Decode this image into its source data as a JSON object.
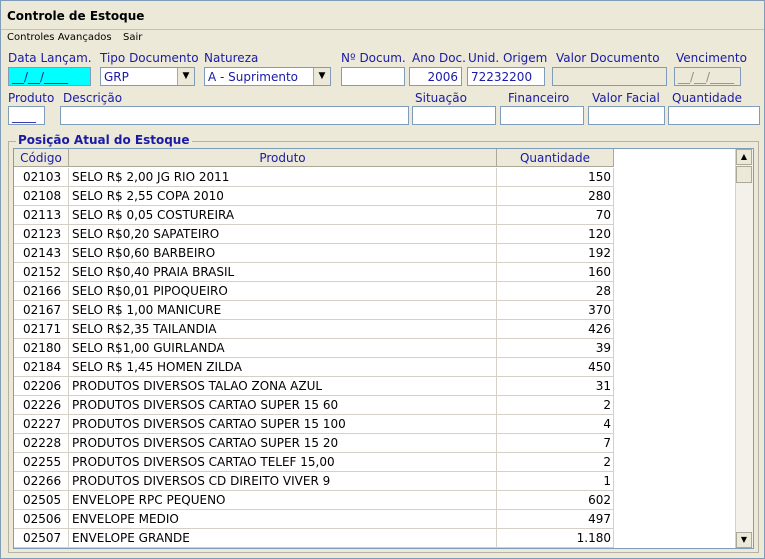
{
  "window": {
    "title": "Controle de Estoque"
  },
  "menu": {
    "items": [
      "Controles Avançados",
      "Sair"
    ]
  },
  "form": {
    "data_lanc": {
      "label": "Data Lançam.",
      "value": "__/__/____"
    },
    "tipo_doc": {
      "label": "Tipo Documento",
      "value": "GRP"
    },
    "natureza": {
      "label": "Natureza",
      "value": "A - Suprimento"
    },
    "num_doc": {
      "label": "Nº Docum.",
      "value": ""
    },
    "ano_doc": {
      "label": "Ano Doc.",
      "value": "2006"
    },
    "unid_origem": {
      "label": "Unid. Origem",
      "value": "72232200"
    },
    "valor_doc": {
      "label": "Valor Documento",
      "value": ""
    },
    "vencimento": {
      "label": "Vencimento",
      "value": "__/__/____"
    },
    "produto": {
      "label": "Produto",
      "value": "____"
    },
    "descricao": {
      "label": "Descrição",
      "value": ""
    },
    "situacao": {
      "label": "Situação",
      "value": ""
    },
    "financeiro": {
      "label": "Financeiro",
      "value": ""
    },
    "valor_facial": {
      "label": "Valor Facial",
      "value": ""
    },
    "quantidade": {
      "label": "Quantidade",
      "value": ""
    }
  },
  "stock": {
    "group_title": "Posição Atual do Estoque",
    "columns": [
      "Código",
      "Produto",
      "Quantidade"
    ],
    "rows": [
      [
        "02103",
        "SELO R$ 2,00 JG RIO 2011",
        "150"
      ],
      [
        "02108",
        "SELO R$ 2,55 COPA 2010",
        "280"
      ],
      [
        "02113",
        "SELO R$ 0,05 COSTUREIRA",
        "70"
      ],
      [
        "02123",
        "SELO R$0,20 SAPATEIRO",
        "120"
      ],
      [
        "02143",
        "SELO R$0,60 BARBEIRO",
        "192"
      ],
      [
        "02152",
        "SELO R$0,40 PRAIA BRASIL",
        "160"
      ],
      [
        "02166",
        "SELO R$0,01 PIPOQUEIRO",
        "28"
      ],
      [
        "02167",
        "SELO R$ 1,00 MANICURE",
        "370"
      ],
      [
        "02171",
        "SELO R$2,35 TAILANDIA",
        "426"
      ],
      [
        "02180",
        "SELO R$1,00 GUIRLANDA",
        "39"
      ],
      [
        "02184",
        "SELO R$ 1,45 HOMEN ZILDA",
        "450"
      ],
      [
        "02206",
        "PRODUTOS DIVERSOS TALAO ZONA AZUL",
        "31"
      ],
      [
        "02226",
        "PRODUTOS DIVERSOS CARTAO SUPER 15  60",
        "2"
      ],
      [
        "02227",
        "PRODUTOS DIVERSOS CARTAO SUPER 15 100",
        "4"
      ],
      [
        "02228",
        "PRODUTOS DIVERSOS CARTAO SUPER 15 20",
        "7"
      ],
      [
        "02255",
        "PRODUTOS DIVERSOS CARTAO TELEF 15,00",
        "2"
      ],
      [
        "02266",
        "PRODUTOS DIVERSOS CD DIREITO VIVER 9",
        "1"
      ],
      [
        "02505",
        "ENVELOPE RPC PEQUENO",
        "602"
      ],
      [
        "02506",
        "ENVELOPE MEDIO",
        "497"
      ],
      [
        "02507",
        "ENVELOPE GRANDE",
        "1.180"
      ]
    ]
  },
  "icons": {
    "dropdown": "chevron-down-icon",
    "scroll_up": "arrow-up-icon",
    "scroll_down": "arrow-down-icon"
  }
}
